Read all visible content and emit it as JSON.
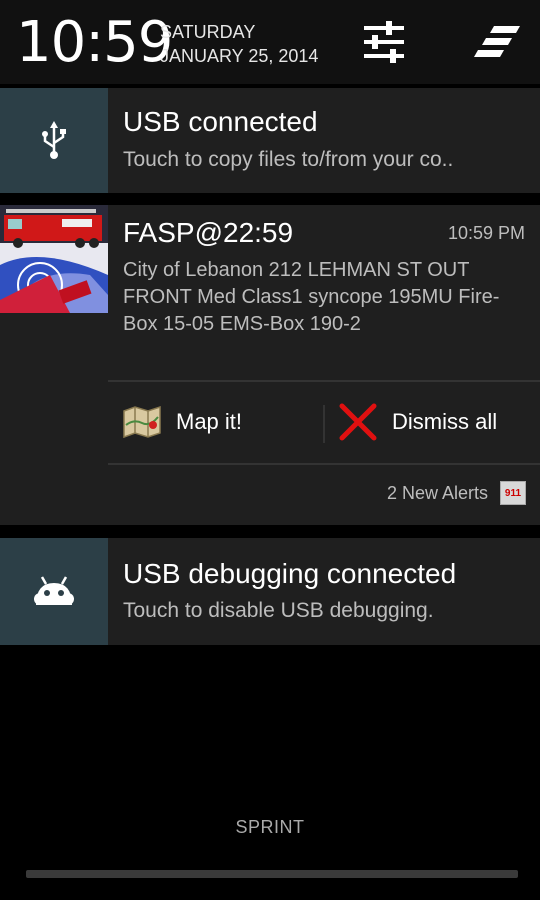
{
  "header": {
    "time": "10:59",
    "day": "SATURDAY",
    "date": "JANUARY 25, 2014",
    "settings_icon": "quick-settings-sliders-icon",
    "clear_icon": "clear-all-icon"
  },
  "notifications": {
    "usb": {
      "title": "USB connected",
      "subtitle": "Touch to copy files to/from your co..",
      "icon": "usb-icon"
    },
    "fasp": {
      "title": "FASP@22:59",
      "time": "10:59 PM",
      "body": "City of Lebanon 212 LEHMAN ST OUT FRONT Med Class1 syncope 195MU Fire-Box 15-05 EMS-Box 190-2",
      "actions": [
        {
          "label": "Map it!",
          "icon": "map-icon"
        },
        {
          "label": "Dismiss all",
          "icon": "x-icon"
        }
      ],
      "alerts_text": "2 New Alerts",
      "badge_text": "911"
    },
    "debug": {
      "title": "USB debugging connected",
      "subtitle": "Touch to disable USB debugging.",
      "icon": "android-icon"
    }
  },
  "footer": {
    "carrier": "SPRINT"
  },
  "colors": {
    "icon_tile": "#2c3f47",
    "card": "#1f1f1f",
    "dismiss_red": "#e01010"
  }
}
